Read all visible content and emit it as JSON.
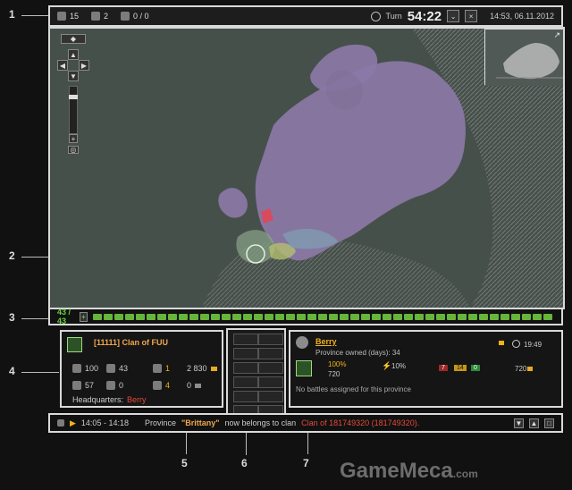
{
  "callouts": {
    "c1": "1",
    "c2": "2",
    "c3": "3",
    "c4": "4",
    "c5": "5",
    "c6": "6",
    "c7": "7"
  },
  "topbar": {
    "players": "15",
    "battles": "2",
    "moves": "0 / 0",
    "turn_label": "Turn",
    "turn_time": "54:22",
    "datetime": "14:53, 06.11.2012"
  },
  "turnbar": {
    "count": "43 / 43"
  },
  "clan_panel": {
    "clan_name": "[11111] Clan of FUU",
    "stat_a": "100",
    "stat_b": "43",
    "stat_c": "1",
    "stat_d": "2 830",
    "stat_e": "57",
    "stat_f": "0",
    "stat_g": "4",
    "stat_h": "0",
    "headquarters_label": "Headquarters:",
    "headquarters_value": "Berry"
  },
  "province_panel": {
    "name": "Berry",
    "owned": "Province owned (days): 34",
    "time": "19:49",
    "percent_a": "100%",
    "value_a": "720",
    "percent_b": "10%",
    "badge_a": "7",
    "badge_b": "14",
    "badge_c": "0",
    "income": "720",
    "status": "No battles assigned for this province"
  },
  "log": {
    "time": "14:05 - 14:18",
    "text_prefix": "Province",
    "province": "\"Brittany\"",
    "text_middle": "now belongs to clan",
    "clan": "Clan of 181749320 (181749320)."
  },
  "watermark": {
    "brand": "GameMeca",
    "suffix": ".com"
  }
}
